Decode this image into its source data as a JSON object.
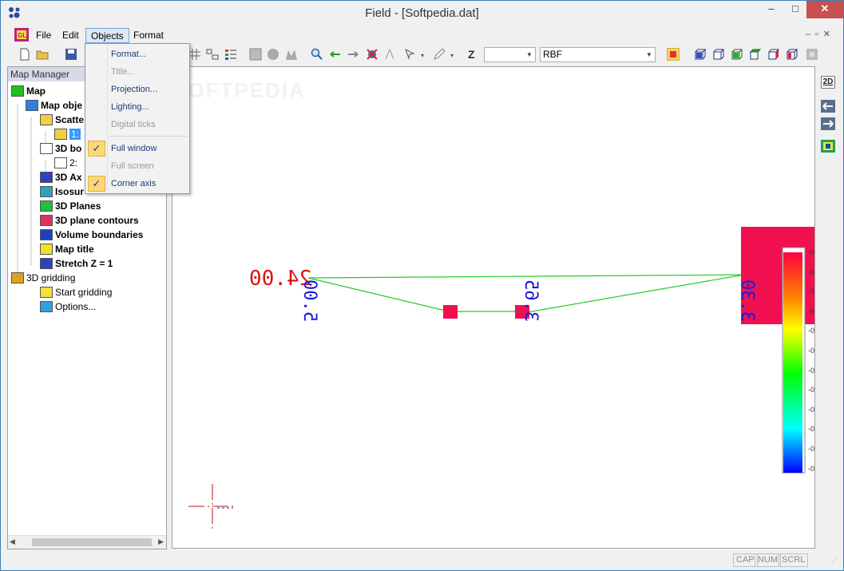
{
  "window": {
    "title": "Field - [Softpedia.dat]",
    "minimize": "–",
    "maximize": "□",
    "close": "✕"
  },
  "menubar": {
    "items": [
      "File",
      "Edit",
      "Objects",
      "Format"
    ],
    "active": "Objects",
    "mdi_controls": "–▫✕"
  },
  "toolbar": {
    "z_label": "Z",
    "z_combo_value": "",
    "method_combo_value": "RBF"
  },
  "objects_menu": {
    "items": [
      {
        "label": "Format...",
        "enabled": true,
        "checked": false
      },
      {
        "label": "Title...",
        "enabled": false,
        "checked": false
      },
      {
        "label": "Projection...",
        "enabled": true,
        "checked": false
      },
      {
        "label": "Lighting...",
        "enabled": true,
        "checked": false
      },
      {
        "label": "Digital ticks",
        "enabled": false,
        "checked": false
      },
      {
        "label": "Full window",
        "enabled": true,
        "checked": true
      },
      {
        "label": "Full screen",
        "enabled": false,
        "checked": false
      },
      {
        "label": "Corner axis",
        "enabled": true,
        "checked": true
      }
    ],
    "check_glyph": "✓"
  },
  "map_manager": {
    "title": "Map Manager",
    "tree": [
      {
        "label": "Map",
        "bold": true,
        "icon": "map-icon"
      },
      {
        "label": "Map obje",
        "bold": true,
        "icon": "map-objects-icon"
      },
      {
        "label": "Scatte",
        "bold": true,
        "icon": "scatter-icon"
      },
      {
        "label": "1: ",
        "bold": false,
        "icon": "scatter-item-icon",
        "selected": true
      },
      {
        "label": "3D bo",
        "bold": true,
        "icon": "box-icon"
      },
      {
        "label": "2: ",
        "bold": false,
        "icon": "box-item-icon"
      },
      {
        "label": "3D Ax",
        "bold": true,
        "icon": "axis-icon"
      },
      {
        "label": "Isosur",
        "bold": true,
        "icon": "isosurface-icon"
      },
      {
        "label": "3D Planes",
        "bold": true,
        "icon": "planes-icon"
      },
      {
        "label": "3D plane contours",
        "bold": true,
        "icon": "contours-icon"
      },
      {
        "label": "Volume boundaries",
        "bold": true,
        "icon": "volume-icon"
      },
      {
        "label": "Map title",
        "bold": true,
        "icon": "title-icon"
      },
      {
        "label": "Stretch Z = 1",
        "bold": true,
        "icon": "stretch-icon"
      },
      {
        "label": "3D gridding",
        "bold": false,
        "icon": "gridding-icon"
      },
      {
        "label": "Start gridding",
        "bold": false,
        "icon": "start-gridding-icon"
      },
      {
        "label": "Options...",
        "bold": false,
        "icon": "options-icon"
      }
    ]
  },
  "canvas": {
    "watermark": "SOFTPEDIA",
    "value_label_red": "24.00",
    "axis_labels": [
      "5.00",
      "3.65",
      "3.30"
    ],
    "colorbar_ticks": [
      "-0",
      "-0",
      "-0",
      "-0",
      "-0",
      "-0",
      "-0",
      "-0",
      "-0",
      "-0",
      "-0",
      "-0"
    ],
    "colors": {
      "axis_text": "#1a1adc",
      "value_text": "#e01010",
      "line": "#22cc22",
      "marker": "#f01050"
    }
  },
  "rightbar": {
    "view_2d": "2D"
  },
  "statusbar": {
    "cap": "CAP",
    "num": "NUM",
    "scrl": "SCRL"
  }
}
